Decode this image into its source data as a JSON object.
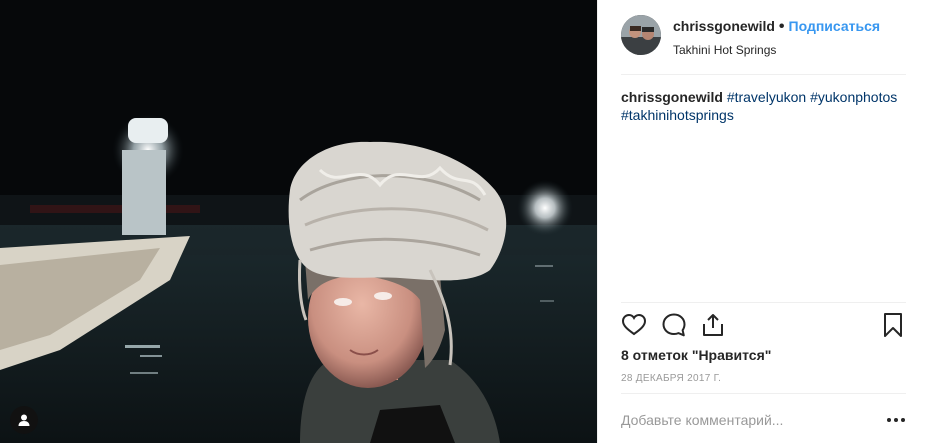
{
  "post": {
    "username": "chrissgonewild",
    "separator": "•",
    "follow_label": "Подписаться",
    "location": "Takhini Hot Springs",
    "caption": {
      "username": "chrissgonewild",
      "hashtags": [
        "#travelyukon",
        "#yukonphotos",
        "#takhinihotsprings"
      ]
    },
    "likes_text": "8 отметок \"Нравится\"",
    "date": "28 декабря 2017 г.",
    "comment_placeholder": "Добавьте комментарий..."
  },
  "icons": {
    "like": "heart-icon",
    "comment": "comment-bubble-icon",
    "share": "share-icon",
    "save": "bookmark-icon",
    "more": "more-options-icon",
    "user_tag": "user-tag-icon"
  },
  "colors": {
    "accent": "#3897f0",
    "hashtag": "#003569",
    "text": "#262626",
    "muted": "#999999",
    "divider": "#efefef"
  }
}
